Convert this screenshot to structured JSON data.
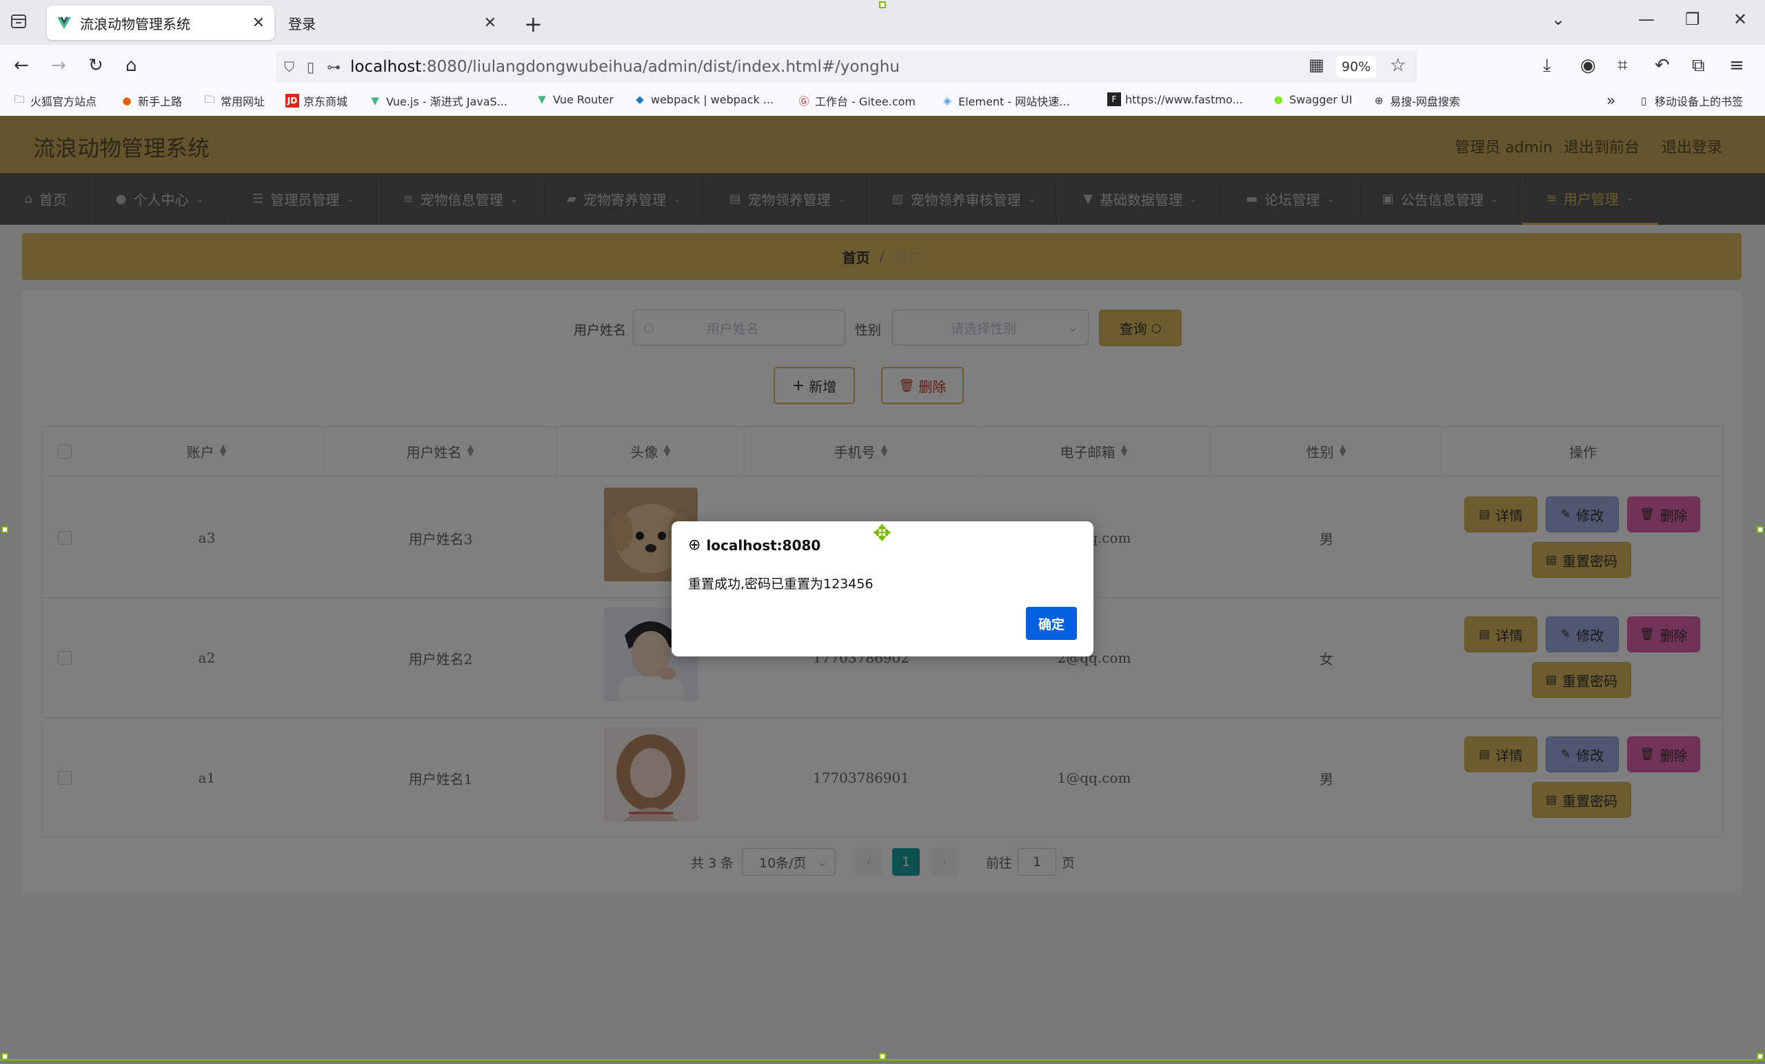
{
  "browser": {
    "tabs": [
      {
        "title": "流浪动物管理系统",
        "active": true
      },
      {
        "title": "登录",
        "active": false
      }
    ],
    "url_host": "localhost",
    "url_path": ":8080/liulangdongwubeihua/admin/dist/index.html#/yonghu",
    "zoom": "90%",
    "bookmarks": [
      "火狐官方站点",
      "新手上路",
      "常用网址",
      "京东商城",
      "Vue.js - 渐进式 JavaS...",
      "Vue Router",
      "webpack | webpack ...",
      "工作台 - Gitee.com",
      "Element - 网站快速...",
      "https://www.fastmo...",
      "Swagger UI",
      "易搜-网盘搜索"
    ],
    "mobile_bookmarks": "移动设备上的书签"
  },
  "app": {
    "title": "流浪动物管理系统",
    "header_links": {
      "admin": "管理员 admin",
      "front": "退出到前台",
      "logout": "退出登录"
    },
    "menu": [
      "首页",
      "个人中心",
      "管理员管理",
      "宠物信息管理",
      "宠物寄养管理",
      "宠物领养管理",
      "宠物领养审核管理",
      "基础数据管理",
      "论坛管理",
      "公告信息管理",
      "用户管理"
    ],
    "breadcrumb": {
      "home": "首页",
      "sep": "/",
      "current": "用户"
    },
    "search": {
      "name_label": "用户姓名",
      "name_placeholder": "用户姓名",
      "gender_label": "性别",
      "gender_placeholder": "请选择性别",
      "query_button": "查询"
    },
    "actions": {
      "add": "新增",
      "delete": "删除"
    },
    "table": {
      "headers": [
        "账户",
        "用户姓名",
        "头像",
        "手机号",
        "电子邮箱",
        "性别",
        "操作"
      ],
      "rows": [
        {
          "account": "a3",
          "name": "用户姓名3",
          "phone": "",
          "email": "3@qq.com",
          "gender": "男"
        },
        {
          "account": "a2",
          "name": "用户姓名2",
          "phone": "17703786902",
          "email": "2@qq.com",
          "gender": "女"
        },
        {
          "account": "a1",
          "name": "用户姓名1",
          "phone": "17703786901",
          "email": "1@qq.com",
          "gender": "男"
        }
      ],
      "row_actions": {
        "detail": "详情",
        "edit": "修改",
        "delete": "删除",
        "reset": "重置密码"
      }
    },
    "pagination": {
      "total": "共 3 条",
      "page_size": "10条/页",
      "current_page": "1",
      "goto_prefix": "前往",
      "goto_value": "1",
      "goto_suffix": "页"
    }
  },
  "dialog": {
    "origin": "localhost:8080",
    "message": "重置成功,密码已重置为123456",
    "ok_button": "确定"
  },
  "colors": {
    "header": "#c9ab5f",
    "menu": "#5a5a5a",
    "accent": "#d9b95f",
    "edit": "#a0aee6",
    "delete": "#e466b0",
    "ok": "#0060df",
    "page_active": "#19a2a0"
  }
}
